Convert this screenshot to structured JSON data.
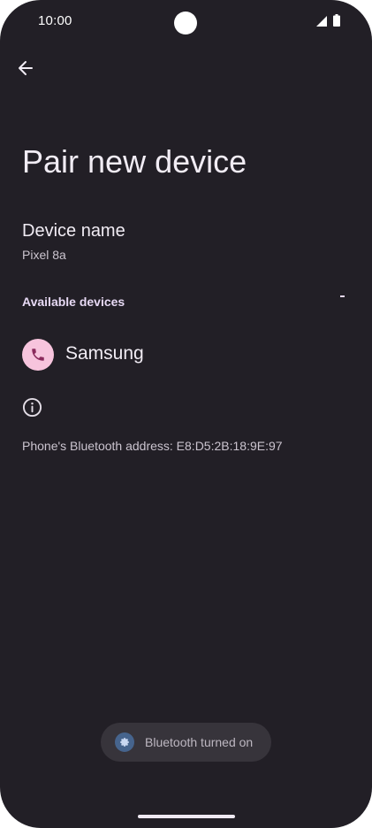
{
  "status_bar": {
    "time": "10:00",
    "signal_icon": "cellular-signal-icon",
    "battery_icon": "battery-icon"
  },
  "header": {
    "back_icon": "arrow-back-icon",
    "title": "Pair new device"
  },
  "device_name": {
    "title": "Device name",
    "value": "Pixel 8a"
  },
  "available_devices": {
    "header": "Available devices",
    "items": [
      {
        "label": "Samsung",
        "icon": "phone-icon"
      }
    ]
  },
  "footer": {
    "info_icon": "info-icon",
    "bluetooth_address": "Phone's Bluetooth address: E8:D5:2B:18:9E:97"
  },
  "toast": {
    "icon": "settings-gear-icon",
    "text": "Bluetooth turned on"
  },
  "colors": {
    "background": "#221f26",
    "accent_pink": "#f7c4dd",
    "toast_background": "#37343b"
  }
}
